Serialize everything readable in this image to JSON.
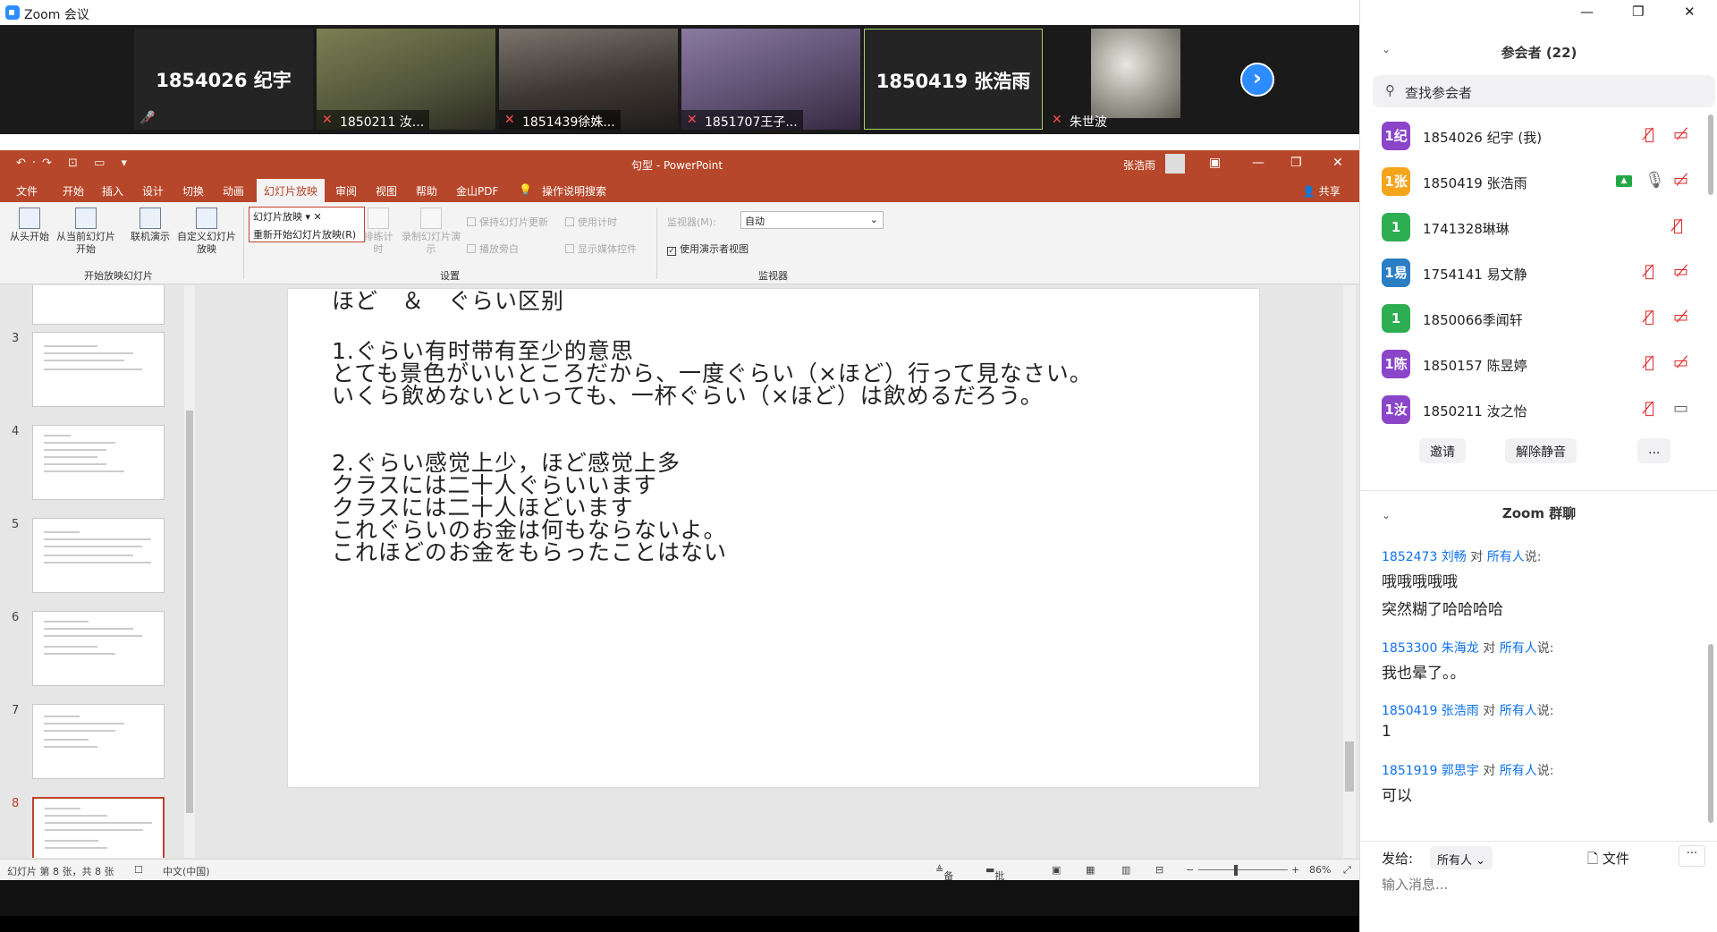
{
  "window": {
    "title": "Zoom 会议"
  },
  "videos": {
    "tiles": [
      {
        "name": "1854026 纪宇",
        "kind": "name"
      },
      {
        "name": "1850211 汝...",
        "kind": "photo",
        "bg": "#6b7048"
      },
      {
        "name": "1851439徐姝...",
        "kind": "photo",
        "bg": "#3f3a36"
      },
      {
        "name": "1851707王子...",
        "kind": "photo",
        "bg": "#5a4c6e"
      },
      {
        "name": "1850419 张浩雨",
        "kind": "name"
      },
      {
        "name": "朱世波",
        "kind": "photo",
        "bg": "#8f8d85"
      }
    ]
  },
  "ppt": {
    "doc_title": "句型 - PowerPoint",
    "user": "张浩雨",
    "tabs": [
      "文件",
      "开始",
      "插入",
      "设计",
      "切换",
      "动画",
      "幻灯片放映",
      "审阅",
      "视图",
      "帮助",
      "金山PDF",
      "操作说明搜索"
    ],
    "share": "共享",
    "ribbon": {
      "from_start": "从头开始",
      "from_current": "从当前幻灯片开始",
      "online": "联机演示",
      "custom": "自定义幻灯片放映",
      "group_start": "开始放映幻灯片",
      "rec_menu_1": "幻灯片放映",
      "rec_menu_2": "重新开始幻灯片放映(R)",
      "rehearse": "排练计时",
      "record": "录制幻灯片演示",
      "keep_updated": "保持幻灯片更新",
      "play_narrations": "播放旁白",
      "use_timings": "使用计时",
      "show_media": "显示媒体控件",
      "group_setup": "设置",
      "monitor_label": "监视器(M):",
      "monitor_value": "自动",
      "presenter_view": "使用演示者视图",
      "group_monitors": "监视器"
    },
    "slide_numbers": [
      "3",
      "4",
      "5",
      "6",
      "7",
      "8"
    ],
    "slide": {
      "heading": "ほど　＆　ぐらい区别",
      "lines": [
        "1.ぐらい有时带有至少的意思",
        "とても景色がいいところだから、一度ぐらい（×ほど）行って見なさい。",
        "いくら飲めないといっても、一杯ぐらい（×ほど）は飲めるだろう。",
        "2.ぐらい感觉上少，ほど感觉上多",
        "クラスには二十人ぐらいいます",
        "クラスには二十人ほどいます",
        "これぐらいのお金は何もならないよ。",
        "これほどのお金をもらったことはない"
      ]
    },
    "status": {
      "slide_info": "幻灯片 第 8 张，共 8 张",
      "language": "中文(中国)",
      "notes": "备注",
      "comments": "批注",
      "zoom": "86%"
    }
  },
  "panel": {
    "participants_title": "参会者 (22)",
    "search_placeholder": "查找参会者",
    "participants": [
      {
        "avatar": "1纪",
        "color": "#8a45c9",
        "name": "1854026 纪宇 (我)",
        "video": "off"
      },
      {
        "avatar": "1张",
        "color": "#f4a51c",
        "name": "1850419 张浩雨",
        "video": "off",
        "sharing": true,
        "mic": "on"
      },
      {
        "avatar": "1",
        "color": "#2eae53",
        "name": "1741328琳琳",
        "video": "none"
      },
      {
        "avatar": "1易",
        "color": "#2a7ec4",
        "name": "1754141 易文静",
        "video": "off"
      },
      {
        "avatar": "1",
        "color": "#2eae53",
        "name": "1850066季闻轩",
        "video": "off"
      },
      {
        "avatar": "1陈",
        "color": "#8a45c9",
        "name": "1850157 陈昱婷",
        "video": "off"
      },
      {
        "avatar": "1汝",
        "color": "#8a45c9",
        "name": "1850211 汝之怡",
        "video": "on"
      }
    ],
    "invite": "邀请",
    "unmute": "解除静音",
    "more": "...",
    "chat_title": "Zoom 群聊",
    "messages": [
      {
        "from": "1852473 刘畅",
        "mid": " 对 ",
        "to": "所有人",
        "suffix": "说:",
        "texts": [
          "哦哦哦哦哦",
          "突然糊了哈哈哈哈"
        ]
      },
      {
        "from": "1853300 朱海龙",
        "mid": " 对 ",
        "to": "所有人",
        "suffix": "说:",
        "texts": [
          "我也晕了。。"
        ]
      },
      {
        "from": "1850419 张浩雨",
        "mid": " 对 ",
        "to": "所有人",
        "suffix": "说:",
        "texts": [
          "1"
        ]
      },
      {
        "from": "1851919 郭思宇",
        "mid": " 对 ",
        "to": "所有人",
        "suffix": "说:",
        "texts": [
          "可以"
        ]
      }
    ],
    "send_to_label": "发给:",
    "send_to_value": "所有人",
    "file": "文件",
    "input_placeholder": "输入消息..."
  }
}
